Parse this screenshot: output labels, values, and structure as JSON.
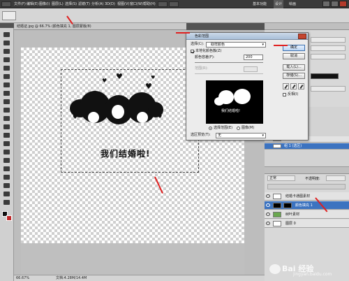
{
  "menubar": {
    "items": [
      "文件(F)",
      "编辑(E)",
      "图像(I)",
      "图层(L)",
      "选择(S)",
      "滤镜(T)",
      "分析(A)",
      "3D(D)",
      "视图(V)",
      "窗口(W)",
      "帮助(H)"
    ],
    "right_labels": [
      "基本功能",
      "设计",
      "绘画"
    ]
  },
  "document": {
    "tab_title": "结婚证.jpg @ 66.7% (颜色填充 1, 图层蒙版/8)",
    "close_glyph": "×",
    "artwork_text": "我们结婚啦!",
    "status_zoom": "66.67%",
    "status_doc": "文档:4.28M/14.4M"
  },
  "dialog": {
    "title": "色彩范围",
    "select_label": "选择(C):",
    "select_value": "取样颜色",
    "localized_label": "本地化颜色簇(Z)",
    "fuzziness_label": "颜色容差(F):",
    "fuzziness_value": "200",
    "range_label": "范围(R):",
    "ok": "确定",
    "cancel": "取消",
    "load": "载入(L)...",
    "save": "存储(S)...",
    "invert_label": "反相(I)",
    "selection_radio": "选择范围(E)",
    "image_radio": "图像(M)",
    "preview_label": "选区预览(T):",
    "preview_value": "无",
    "preview_text": "我们结婚啦!"
  },
  "layers": {
    "blend_mode": "正常",
    "opacity_label": "不透明度:",
    "items": [
      {
        "name": "结婚卡通图素材",
        "selected": false
      },
      {
        "name": "颜色填充 1",
        "selected": true
      },
      {
        "name": "树叶素材",
        "selected": false
      },
      {
        "name": "图层 0",
        "selected": false
      }
    ],
    "top_items": [
      "路径选区",
      "组 1 (选区)"
    ]
  },
  "watermark": {
    "brand": "Bai 经验",
    "url": "jingyan.baidu.com"
  },
  "colors": {
    "accent_red": "#e02020",
    "layer_selected": "#3c73c0"
  }
}
